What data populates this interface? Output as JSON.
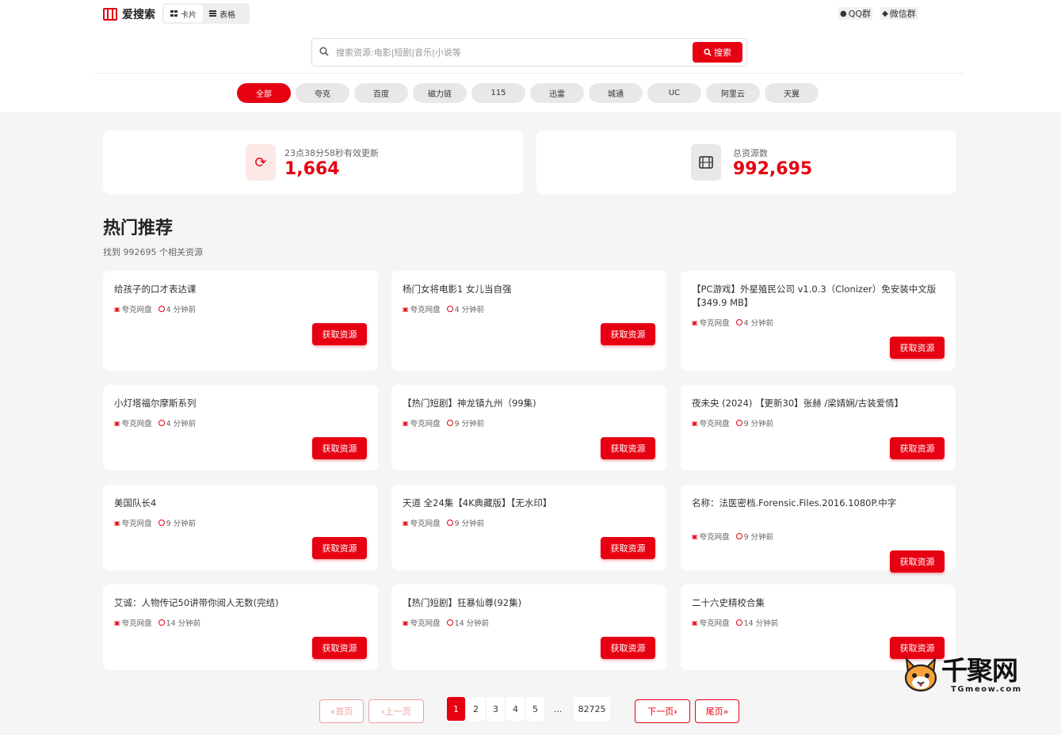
{
  "app": {
    "name": "爱搜索"
  },
  "view_toggle": {
    "card": "卡片",
    "table": "表格"
  },
  "top_links": {
    "qq": "QQ群",
    "wechat": "微信群"
  },
  "search": {
    "placeholder": "搜索资源:电影|短剧|音乐|小说等",
    "button": "搜索"
  },
  "categories": [
    "全部",
    "夸克",
    "百度",
    "磁力链",
    "115",
    "迅雷",
    "城通",
    "UC",
    "阿里云",
    "天翼"
  ],
  "stats": {
    "updated": {
      "label": "23点38分58秒有效更新",
      "value": "1,664"
    },
    "total": {
      "label": "总资源数",
      "value": "992,695"
    }
  },
  "section": {
    "title": "热门推荐",
    "subtitle": "找到 992695 个相关资源"
  },
  "cards": [
    {
      "title": "给孩子的口才表达课",
      "source": "夸克网盘",
      "time": "4 分钟前"
    },
    {
      "title": "杨门女将电影1 女儿当自强",
      "source": "夸克网盘",
      "time": "4 分钟前"
    },
    {
      "title": "【PC游戏】外星殖民公司 v1.0.3（Clonizer）免安装中文版【349.9 MB】",
      "source": "夸克网盘",
      "time": "4 分钟前"
    },
    {
      "title": "小灯塔福尔摩斯系列",
      "source": "夸克网盘",
      "time": "4 分钟前"
    },
    {
      "title": "【热门短剧】神龙镇九州（99集)",
      "source": "夸克网盘",
      "time": "9 分钟前"
    },
    {
      "title": "夜未央 (2024) 【更新30】张赫 /梁婧娴/古装爱情】",
      "source": "夸克网盘",
      "time": "9 分钟前"
    },
    {
      "title": "美国队长4",
      "source": "夸克网盘",
      "time": "9 分钟前"
    },
    {
      "title": "天道 全24集【4K典藏版】【无水印】",
      "source": "夸克网盘",
      "time": "9 分钟前"
    },
    {
      "title": "名称：法医密档.Forensic.Files.2016.1080P.中字",
      "source": "夸克网盘",
      "time": "9 分钟前"
    },
    {
      "title": "艾诚：人物传记50讲带你阅人无数(完结)",
      "source": "夸克网盘",
      "time": "14 分钟前"
    },
    {
      "title": "【热门短剧】狂暴仙尊(92集)",
      "source": "夸克网盘",
      "time": "14 分钟前"
    },
    {
      "title": "二十六史精校合集",
      "source": "夸克网盘",
      "time": "14 分钟前"
    }
  ],
  "card_button": "获取资源",
  "pagination": {
    "first": "«首页",
    "prev": "上一页",
    "pages": [
      "1",
      "2",
      "3",
      "4",
      "5"
    ],
    "ellipsis": "...",
    "last_page": "82725",
    "next": "下一页",
    "end": "尾页»"
  },
  "watermark": {
    "text": "千聚网",
    "sub": "TGmeow.com"
  },
  "colors": {
    "accent": "#e60012"
  }
}
